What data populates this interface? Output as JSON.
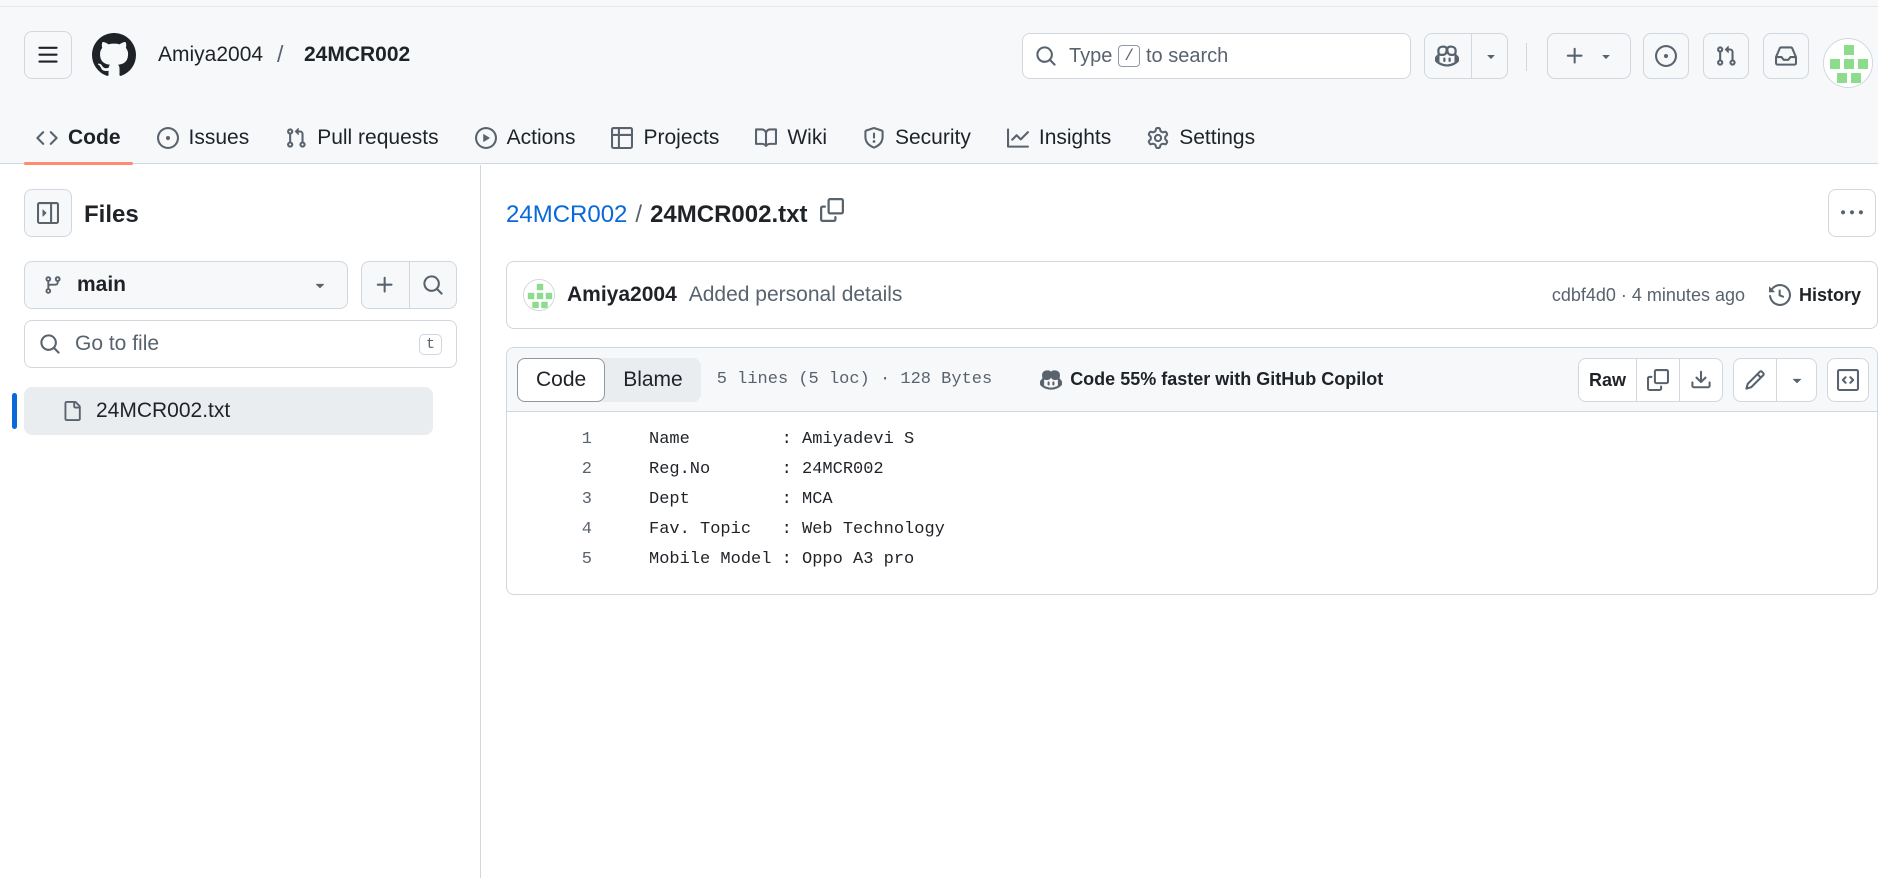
{
  "header": {
    "owner": "Amiya2004",
    "separator": "/",
    "repo": "24MCR002",
    "search_prefix": "Type",
    "search_key": "/",
    "search_suffix": "to search"
  },
  "tabs": [
    {
      "label": "Code",
      "icon": "code-icon",
      "active": true
    },
    {
      "label": "Issues",
      "icon": "issue-icon"
    },
    {
      "label": "Pull requests",
      "icon": "pull-request-icon"
    },
    {
      "label": "Actions",
      "icon": "play-icon"
    },
    {
      "label": "Projects",
      "icon": "table-icon"
    },
    {
      "label": "Wiki",
      "icon": "book-icon"
    },
    {
      "label": "Security",
      "icon": "shield-icon"
    },
    {
      "label": "Insights",
      "icon": "graph-icon"
    },
    {
      "label": "Settings",
      "icon": "gear-icon"
    }
  ],
  "sidebar": {
    "title": "Files",
    "branch": "main",
    "goto_placeholder": "Go to file",
    "goto_shortcut": "t",
    "files": [
      {
        "name": "24MCR002.txt",
        "selected": true
      }
    ]
  },
  "file": {
    "repo_link": "24MCR002",
    "separator": "/",
    "name": "24MCR002.txt",
    "commit": {
      "author": "Amiya2004",
      "message": "Added personal details",
      "sha_time": "cdbf4d0 · 4 minutes ago",
      "history_label": "History"
    },
    "view_code": "Code",
    "view_blame": "Blame",
    "info": "5 lines (5 loc) · 128 Bytes",
    "copilot_promo": "Code 55% faster with GitHub Copilot",
    "raw_label": "Raw",
    "lines": [
      {
        "n": "1",
        "text": "Name         : Amiyadevi S"
      },
      {
        "n": "2",
        "text": "Reg.No       : 24MCR002"
      },
      {
        "n": "3",
        "text": "Dept         : MCA"
      },
      {
        "n": "4",
        "text": "Fav. Topic   : Web Technology"
      },
      {
        "n": "5",
        "text": "Mobile Model : Oppo A3 pro"
      }
    ]
  },
  "colors": {
    "accent": "#0969da",
    "tab_underline": "#fd8c73",
    "avatar_green": "#8ddb8c"
  }
}
